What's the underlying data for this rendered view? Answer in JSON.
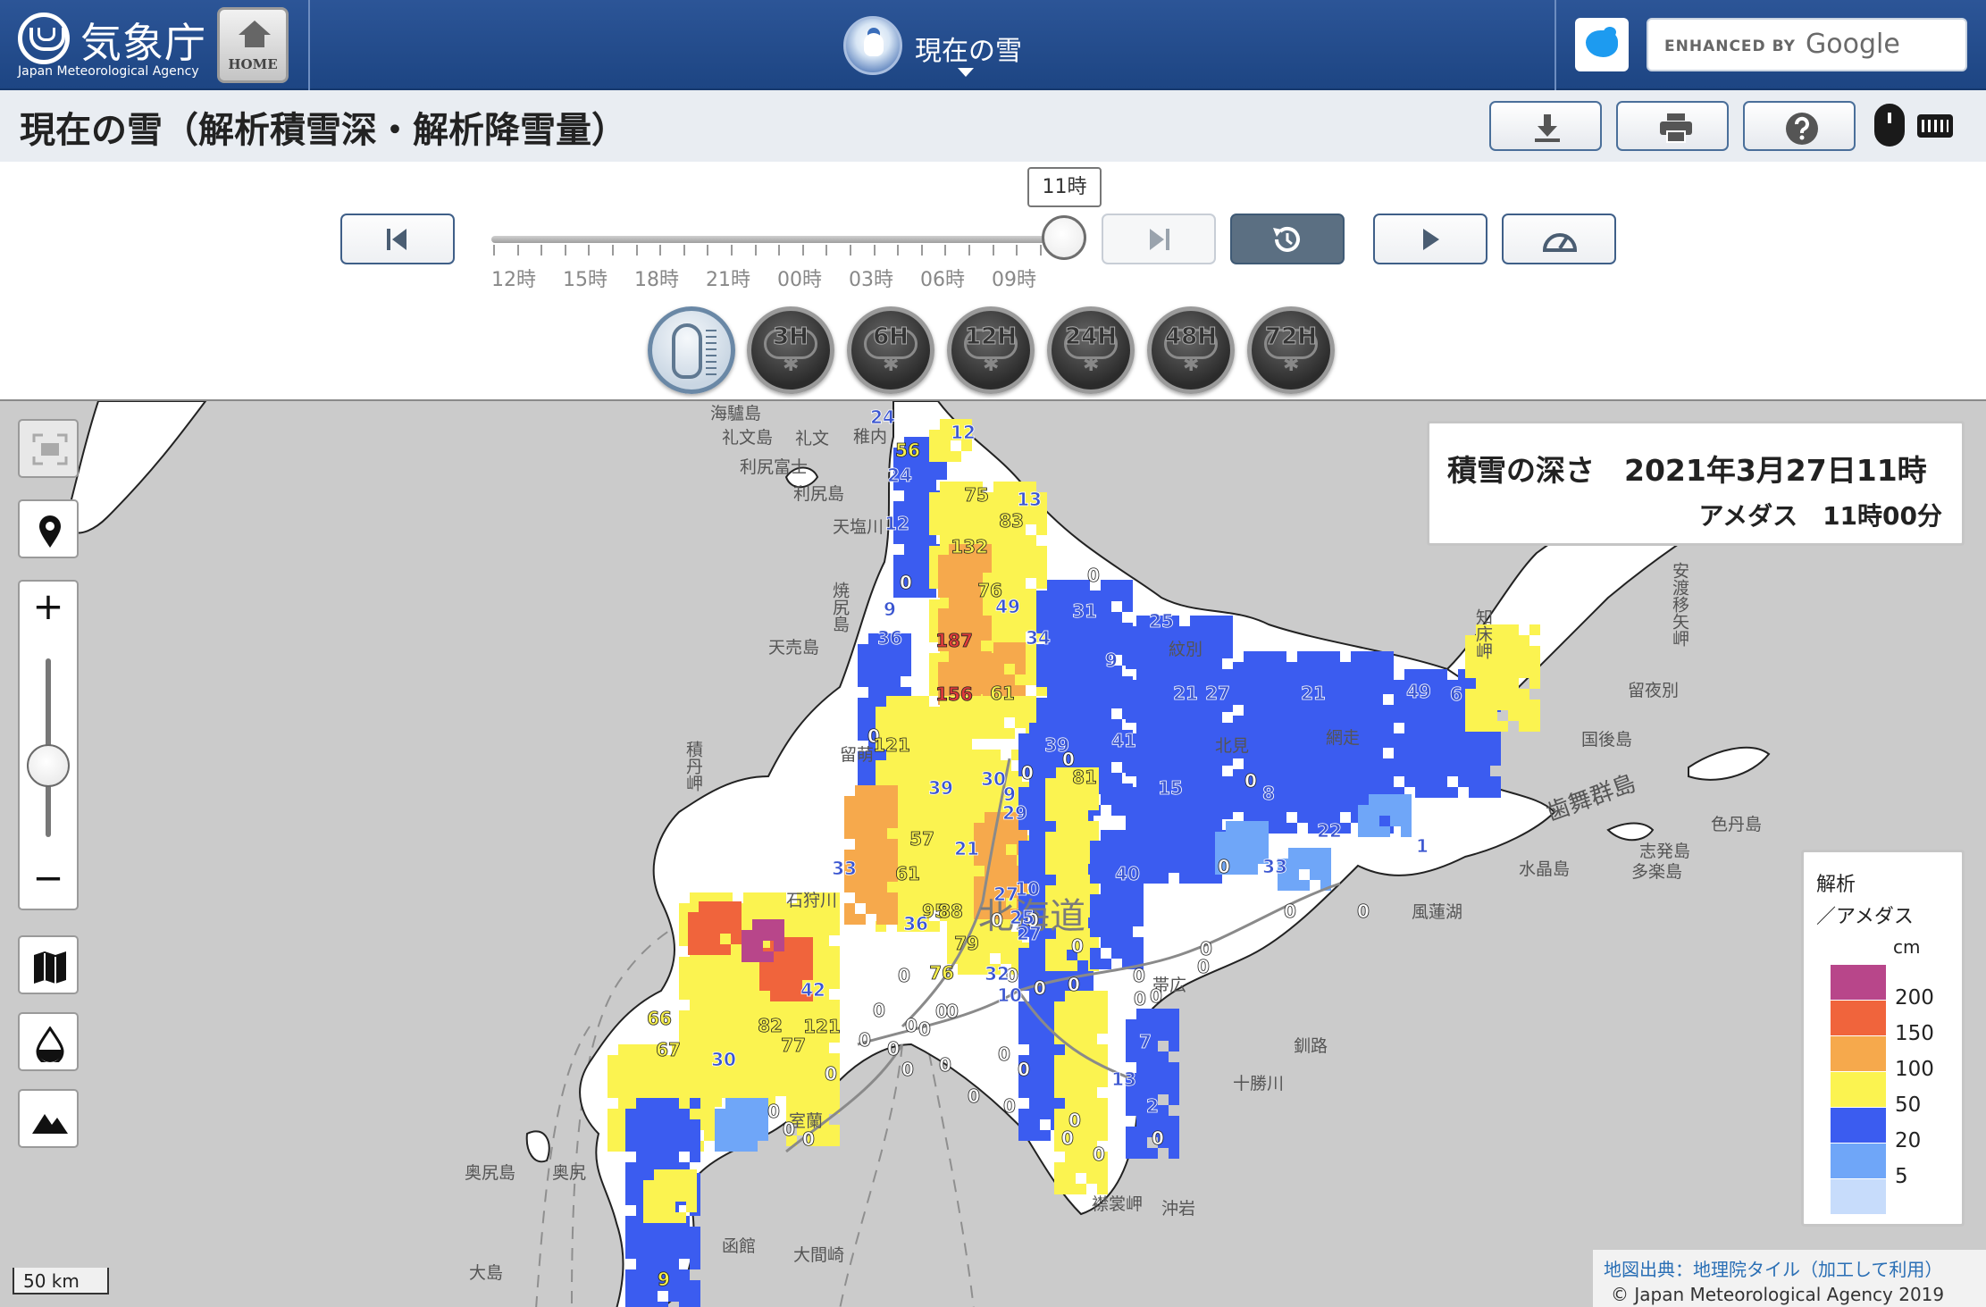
{
  "header": {
    "logo_ja": "気象庁",
    "logo_en": "Japan Meteorological Agency",
    "home_label": "HOME",
    "nav_title": "現在の雪",
    "search_small": "ENHANCED BY",
    "search_google": "Google"
  },
  "page_title": "現在の雪（解析積雪深・解析降雪量）",
  "toolbar": {
    "icons": [
      "download-icon",
      "print-icon",
      "help-icon",
      "mouse-icon",
      "keyboard-icon"
    ]
  },
  "timeline": {
    "current_tooltip": "11時",
    "tick_labels": [
      "12時",
      "15時",
      "18時",
      "21時",
      "00時",
      "03時",
      "06時",
      "09時"
    ],
    "position": 1.0
  },
  "element_buttons": [
    "3H",
    "6H",
    "12H",
    "24H",
    "48H",
    "72H"
  ],
  "map": {
    "info_title": "積雪の深さ　2021年3月27日11時",
    "info_sub": "アメダス　11時00分",
    "legend": {
      "title1": "解析",
      "title2": "／アメダス",
      "unit": "cm",
      "colors": [
        "#b8468a",
        "#f0643c",
        "#f6a94c",
        "#fbf350",
        "#3b5cf0",
        "#6fa6f8",
        "#c7dcfb"
      ],
      "labels": [
        "200",
        "150",
        "100",
        "50",
        "20",
        "5"
      ]
    },
    "attribution1": "地図出典：地理院タイル（加工して利用）",
    "attribution2": "© Japan Meteorological Agency 2019",
    "scale": "50 km",
    "zoom_level": 0.4,
    "place_names": [
      {
        "t": "海驢島"
      },
      {
        "t": "礼文島"
      },
      {
        "t": "礼文"
      },
      {
        "t": "稚内"
      },
      {
        "t": "利尻富士"
      },
      {
        "t": "利尻島"
      },
      {
        "t": "天塩川"
      },
      {
        "t": "焼尻島"
      },
      {
        "t": "天売島"
      },
      {
        "t": "紋別"
      },
      {
        "t": "網走"
      },
      {
        "t": "留萌"
      },
      {
        "t": "留夜別"
      },
      {
        "t": "国後島"
      },
      {
        "t": "色丹島"
      },
      {
        "t": "歯舞群島"
      },
      {
        "t": "水晶島"
      },
      {
        "t": "志発島"
      },
      {
        "t": "多楽島"
      },
      {
        "t": "積丹岬"
      },
      {
        "t": "石狩川"
      },
      {
        "t": "北海道"
      },
      {
        "t": "帯広"
      },
      {
        "t": "釧路"
      },
      {
        "t": "十勝川"
      },
      {
        "t": "室蘭"
      },
      {
        "t": "奥尻島"
      },
      {
        "t": "奥尻"
      },
      {
        "t": "函館"
      },
      {
        "t": "大島"
      },
      {
        "t": "大間崎"
      },
      {
        "t": "襟裳岬"
      },
      {
        "t": "沖岩"
      },
      {
        "t": "風蓮湖"
      },
      {
        "t": "知床岬"
      },
      {
        "t": "安渡移矢岬"
      },
      {
        "t": "択捉島"
      },
      {
        "t": "北見"
      }
    ],
    "station_values": [
      {
        "v": "24",
        "c": "blue"
      },
      {
        "v": "12",
        "c": "blue"
      },
      {
        "v": "56",
        "c": "yellow"
      },
      {
        "v": "24",
        "c": "blue"
      },
      {
        "v": "75",
        "c": "yellow"
      },
      {
        "v": "13",
        "c": "blue"
      },
      {
        "v": "12",
        "c": "blue"
      },
      {
        "v": "83",
        "c": "yellow"
      },
      {
        "v": "132",
        "c": "yellow"
      },
      {
        "v": "0",
        "c": "white"
      },
      {
        "v": "76",
        "c": "yellow"
      },
      {
        "v": "0",
        "c": "white"
      },
      {
        "v": "9",
        "c": "blue"
      },
      {
        "v": "49",
        "c": "blue"
      },
      {
        "v": "31",
        "c": "blue"
      },
      {
        "v": "25",
        "c": "blue"
      },
      {
        "v": "36",
        "c": "blue"
      },
      {
        "v": "187",
        "c": "red"
      },
      {
        "v": "34",
        "c": "blue"
      },
      {
        "v": "9",
        "c": "blue"
      },
      {
        "v": "156",
        "c": "red"
      },
      {
        "v": "61",
        "c": "yellow"
      },
      {
        "v": "21",
        "c": "blue"
      },
      {
        "v": "27",
        "c": "blue"
      },
      {
        "v": "21",
        "c": "blue"
      },
      {
        "v": "49",
        "c": "blue"
      },
      {
        "v": "6",
        "c": "blue"
      },
      {
        "v": "0",
        "c": "white"
      },
      {
        "v": "121",
        "c": "yellow"
      },
      {
        "v": "39",
        "c": "blue"
      },
      {
        "v": "41",
        "c": "blue"
      },
      {
        "v": "0",
        "c": "white"
      },
      {
        "v": "0",
        "c": "white"
      },
      {
        "v": "81",
        "c": "yellow"
      },
      {
        "v": "15",
        "c": "blue"
      },
      {
        "v": "39",
        "c": "blue"
      },
      {
        "v": "30",
        "c": "blue"
      },
      {
        "v": "0",
        "c": "white"
      },
      {
        "v": "8",
        "c": "blue"
      },
      {
        "v": "22",
        "c": "blue"
      },
      {
        "v": "9",
        "c": "blue"
      },
      {
        "v": "29",
        "c": "blue"
      },
      {
        "v": "57",
        "c": "yellow"
      },
      {
        "v": "1",
        "c": "blue"
      },
      {
        "v": "21",
        "c": "blue"
      },
      {
        "v": "33",
        "c": "blue"
      },
      {
        "v": "0",
        "c": "white"
      },
      {
        "v": "33",
        "c": "blue"
      },
      {
        "v": "61",
        "c": "yellow"
      },
      {
        "v": "40",
        "c": "blue"
      },
      {
        "v": "0",
        "c": "white"
      },
      {
        "v": "0",
        "c": "white"
      },
      {
        "v": "27",
        "c": "blue"
      },
      {
        "v": "25",
        "c": "blue"
      },
      {
        "v": "10",
        "c": "blue"
      },
      {
        "v": "95",
        "c": "yellow"
      },
      {
        "v": "88",
        "c": "yellow"
      },
      {
        "v": "36",
        "c": "blue"
      },
      {
        "v": "27",
        "c": "blue"
      },
      {
        "v": "0",
        "c": "white"
      },
      {
        "v": "0",
        "c": "white"
      },
      {
        "v": "0",
        "c": "white"
      },
      {
        "v": "0",
        "c": "white"
      },
      {
        "v": "79",
        "c": "yellow"
      },
      {
        "v": "0",
        "c": "white"
      },
      {
        "v": "76",
        "c": "yellow"
      },
      {
        "v": "0",
        "c": "white"
      },
      {
        "v": "0",
        "c": "white"
      },
      {
        "v": "0",
        "c": "white"
      },
      {
        "v": "42",
        "c": "blue"
      },
      {
        "v": "32",
        "c": "blue"
      },
      {
        "v": "0",
        "c": "white"
      },
      {
        "v": "0",
        "c": "white"
      },
      {
        "v": "0",
        "c": "white"
      },
      {
        "v": "121",
        "c": "yellow"
      },
      {
        "v": "0",
        "c": "white"
      },
      {
        "v": "10",
        "c": "blue"
      },
      {
        "v": "0",
        "c": "white"
      },
      {
        "v": "0",
        "c": "white"
      },
      {
        "v": "66",
        "c": "yellow"
      },
      {
        "v": "82",
        "c": "yellow"
      },
      {
        "v": "0",
        "c": "white"
      },
      {
        "v": "0",
        "c": "white"
      },
      {
        "v": "0",
        "c": "white"
      },
      {
        "v": "0",
        "c": "white"
      },
      {
        "v": "7",
        "c": "blue"
      },
      {
        "v": "67",
        "c": "yellow"
      },
      {
        "v": "77",
        "c": "yellow"
      },
      {
        "v": "0",
        "c": "white"
      },
      {
        "v": "0",
        "c": "white"
      },
      {
        "v": "13",
        "c": "blue"
      },
      {
        "v": "30",
        "c": "blue"
      },
      {
        "v": "0",
        "c": "white"
      },
      {
        "v": "0",
        "c": "white"
      },
      {
        "v": "0",
        "c": "white"
      },
      {
        "v": "2",
        "c": "blue"
      },
      {
        "v": "0",
        "c": "white"
      },
      {
        "v": "0",
        "c": "white"
      },
      {
        "v": "0",
        "c": "white"
      },
      {
        "v": "0",
        "c": "white"
      },
      {
        "v": "0",
        "c": "white"
      },
      {
        "v": "0",
        "c": "white"
      },
      {
        "v": "0",
        "c": "white"
      },
      {
        "v": "0",
        "c": "white"
      },
      {
        "v": "0",
        "c": "white"
      },
      {
        "v": "0",
        "c": "white"
      },
      {
        "v": "9",
        "c": "yellow"
      }
    ]
  }
}
